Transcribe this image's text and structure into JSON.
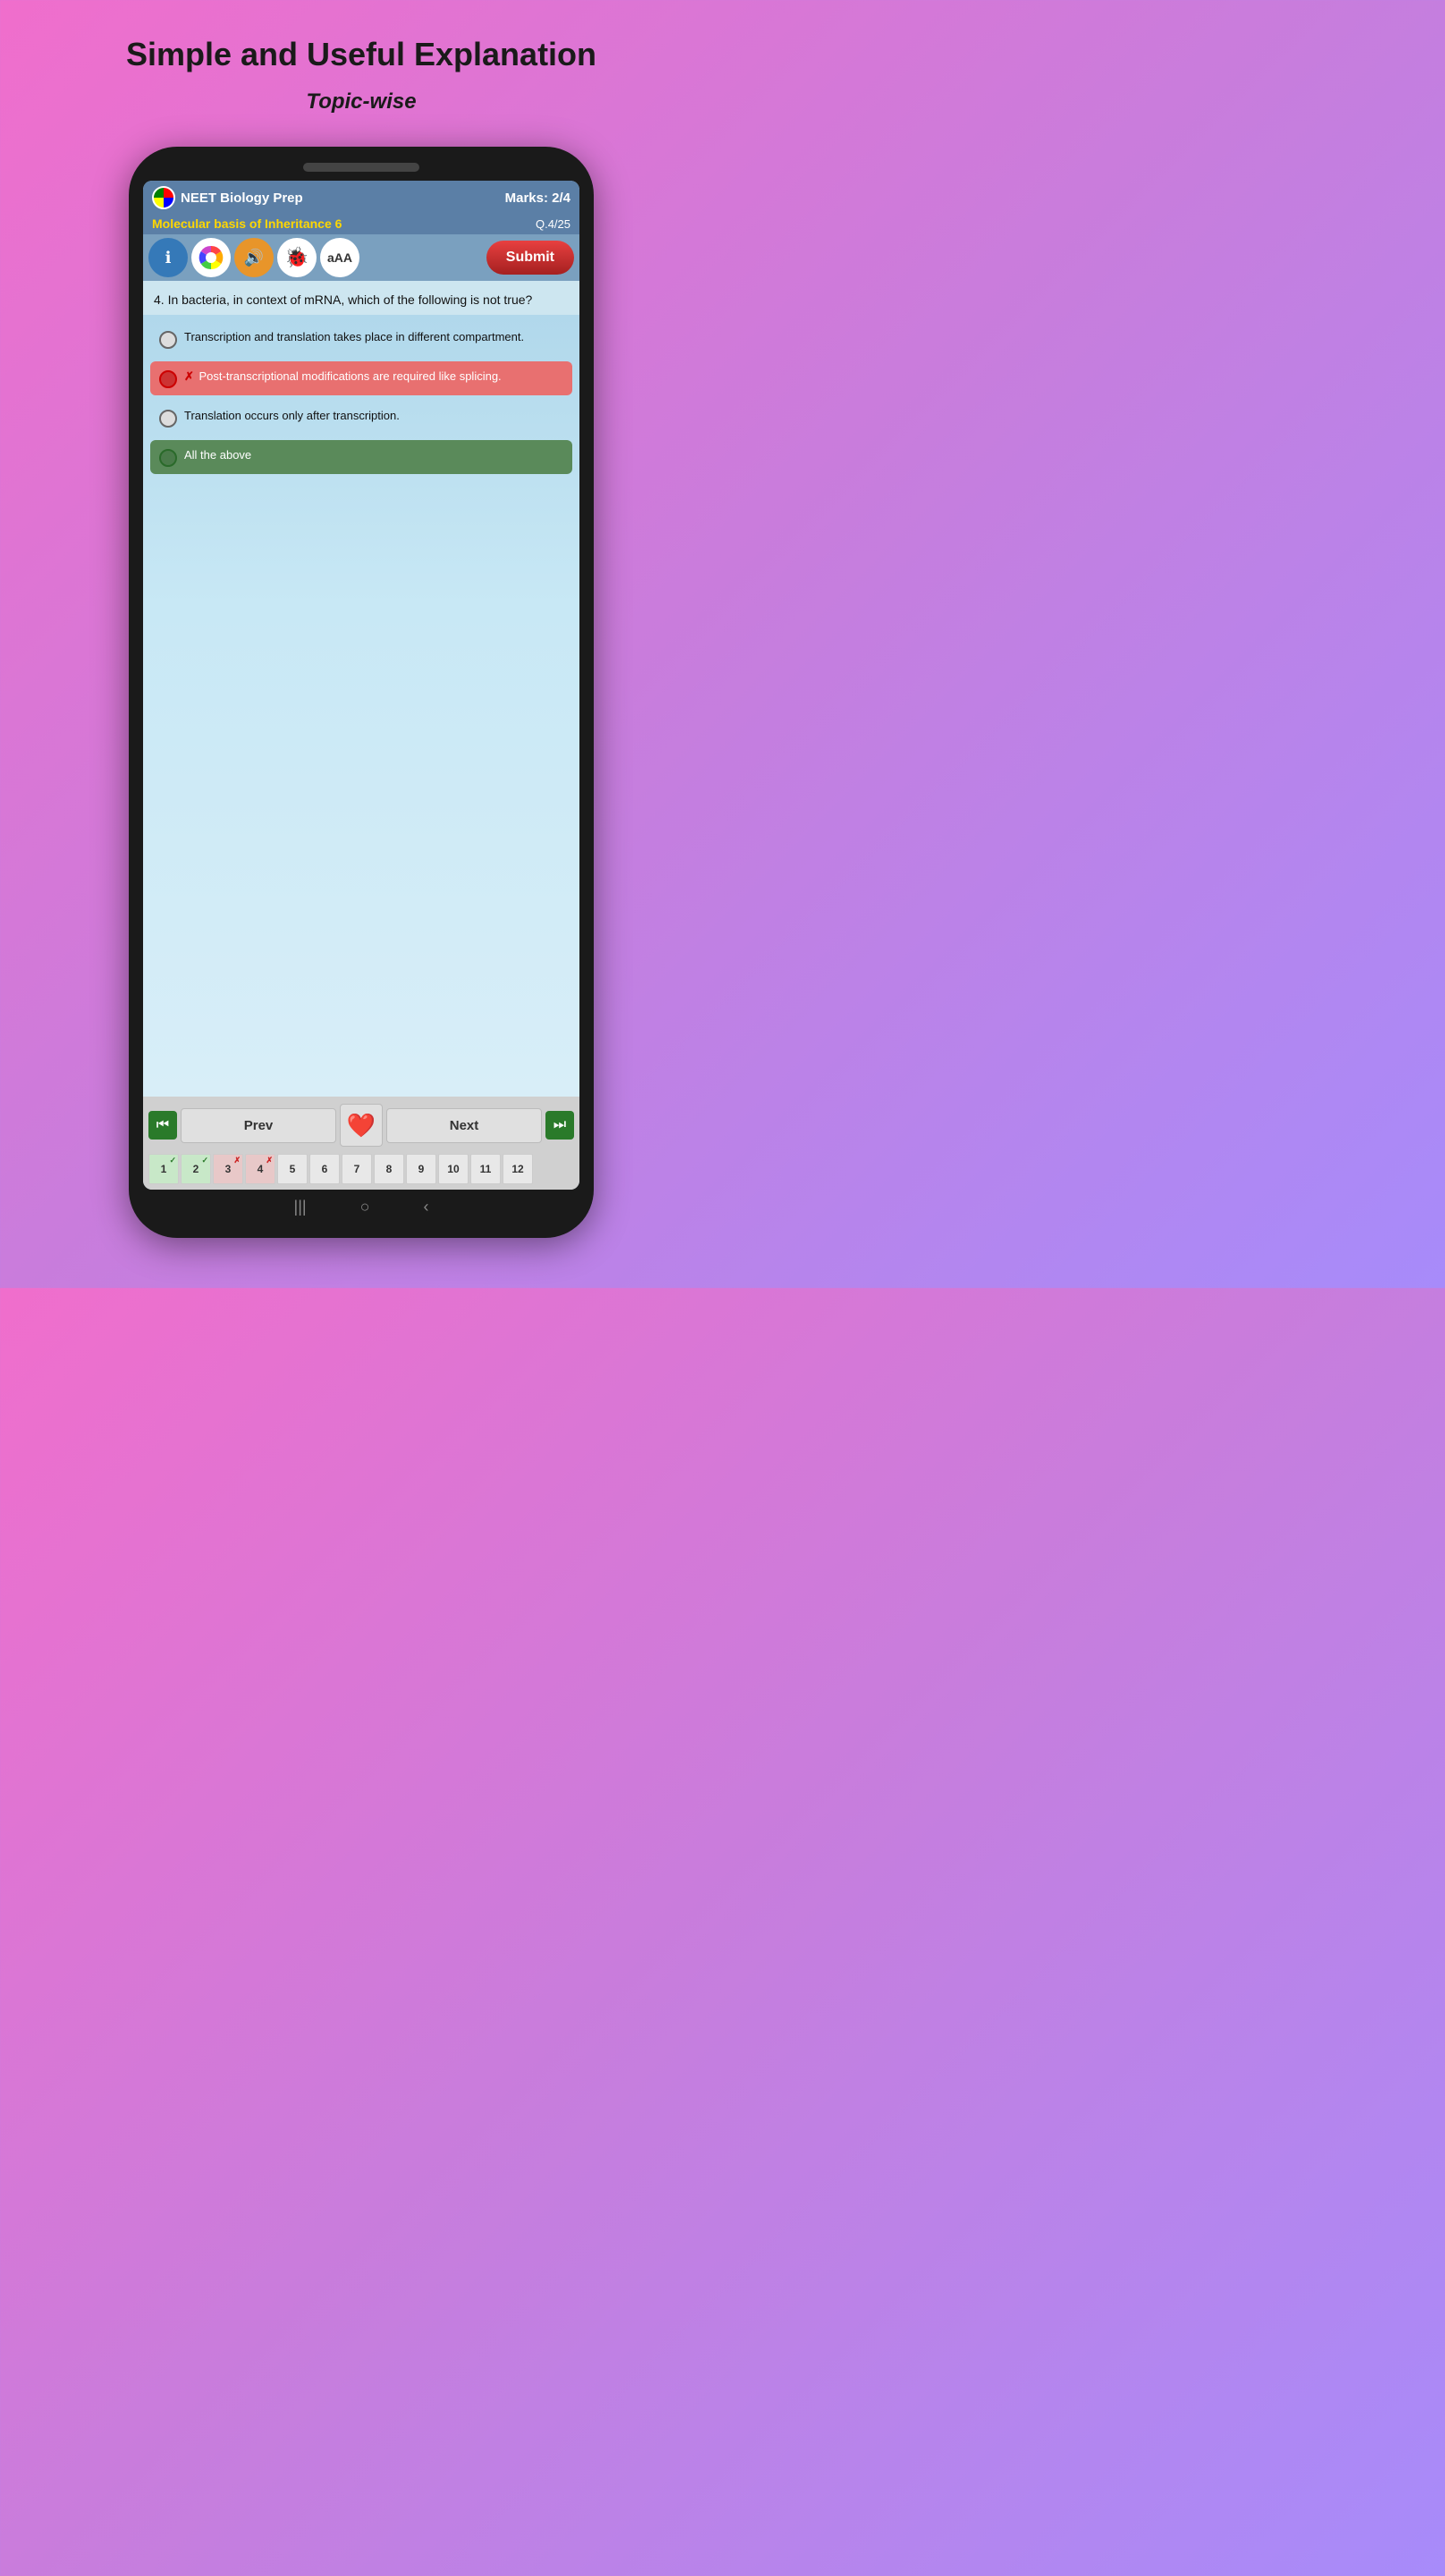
{
  "page": {
    "title": "Simple and Useful Explanation",
    "subtitle": "Topic-wise"
  },
  "app": {
    "name": "NEET Biology Prep",
    "marks": "Marks: 2/4",
    "topic": "Molecular basis of Inheritance 6",
    "question_num": "Q.4/25",
    "submit_label": "Submit"
  },
  "toolbar": {
    "info_icon": "ℹ",
    "sound_icon": "🔊",
    "bug_icon": "🐞",
    "text_size_icon": "aAA"
  },
  "question": {
    "number": "4",
    "text": "4. In bacteria, in context of mRNA, which of the following is not true?"
  },
  "options": [
    {
      "id": "A",
      "text": "Transcription and translation takes place in different compartment.",
      "state": "normal"
    },
    {
      "id": "B",
      "text": "Post-transcriptional modifications are required like splicing.",
      "state": "wrong-selected",
      "prefix": "✗"
    },
    {
      "id": "C",
      "text": "Translation occurs only after transcription.",
      "state": "normal"
    },
    {
      "id": "D",
      "text": "All the above",
      "state": "correct-selected"
    }
  ],
  "navigation": {
    "prev_label": "Prev",
    "next_label": "Next"
  },
  "question_grid": [
    {
      "num": 1,
      "state": "correct",
      "mark": "✓"
    },
    {
      "num": 2,
      "state": "correct",
      "mark": "✓"
    },
    {
      "num": 3,
      "state": "wrong",
      "mark": "✗"
    },
    {
      "num": 4,
      "state": "wrong",
      "mark": "✗"
    },
    {
      "num": 5,
      "state": "normal",
      "mark": ""
    },
    {
      "num": 6,
      "state": "normal",
      "mark": ""
    },
    {
      "num": 7,
      "state": "normal",
      "mark": ""
    },
    {
      "num": 8,
      "state": "normal",
      "mark": ""
    },
    {
      "num": 9,
      "state": "normal",
      "mark": ""
    },
    {
      "num": 10,
      "state": "normal",
      "mark": ""
    },
    {
      "num": 11,
      "state": "normal",
      "mark": ""
    },
    {
      "num": 12,
      "state": "normal",
      "mark": ""
    }
  ],
  "android_nav": {
    "menu": "|||",
    "home": "○",
    "back": "‹"
  }
}
